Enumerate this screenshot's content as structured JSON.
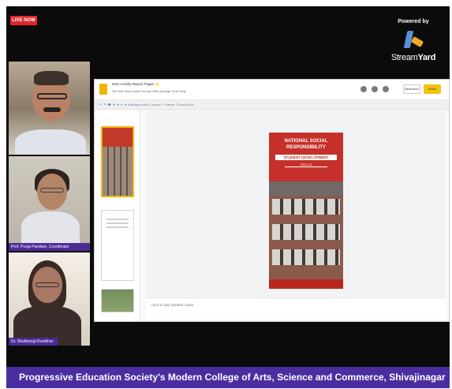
{
  "stream": {
    "live_badge": "LIVE NOW",
    "powered_by": "Powered by",
    "brand_main": "Stream",
    "brand_bold": "Yard"
  },
  "participants": [
    {
      "name": ""
    },
    {
      "name": "Prof. Pooja Pandare, Coordinator"
    },
    {
      "name": "Dr. Shubhangi Kumbhar"
    }
  ],
  "presentation": {
    "title": "NSS Activity Report Pages ⭐",
    "menu": "File  Edit  View  Insert  Format  Slide  Arrange  Tools  Help",
    "present_label": "Slideshow",
    "share_label": "Share",
    "toolbar": "↶ ↷ 🖶 ⊕ ▾ ▭ ▾ Background  Layout  Theme  Transition",
    "speaker_notes": "Click to add speaker notes",
    "poster": {
      "title": "NATIONAL SOCIAL RESPONSIBILITY",
      "subtitle": "STUDENT DEVELOPMENT",
      "subtitle2": "2022-23"
    }
  },
  "banner_text": "Progressive Education Society's Modern College of Arts, Science and Commerce, Shivajinagar",
  "colors": {
    "banner": "#4a2ea0",
    "live": "#e0262b",
    "accent": "#f4b400",
    "poster": "#c5312a"
  }
}
